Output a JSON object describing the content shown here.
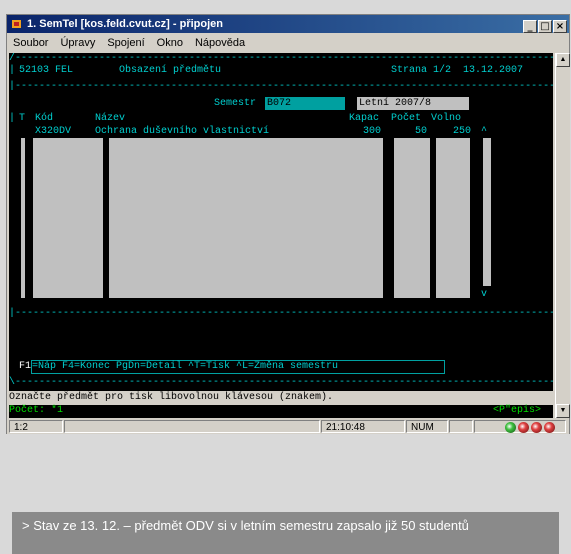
{
  "window": {
    "title": "1. SemTel [kos.feld.cvut.cz] - připojen",
    "controls": [
      "_",
      "□",
      "×"
    ]
  },
  "menu": [
    "Soubor",
    "Úpravy",
    "Spojení",
    "Okno",
    "Nápověda"
  ],
  "terminal": {
    "header_left": "52103 FEL",
    "header_title": "Obsazení předmětu",
    "header_page": "Strana 1/2",
    "header_date": "13.12.2007",
    "semestr_label": "Semestr",
    "semestr_code": "B072",
    "semestr_name": "Letní 2007/8",
    "columns": {
      "t": "T",
      "kod": "Kód",
      "nazev": "Název",
      "kapac": "Kapac",
      "pocet": "Počet",
      "volno": "Volno"
    },
    "rows": [
      {
        "kod": "X320DV",
        "nazev": "Ochrana duševního vlastnictví",
        "kapac": "300",
        "pocet": "50",
        "volno": "250"
      }
    ],
    "scroll_up": "^",
    "scroll_down": "v",
    "fkeys_label": "F1",
    "fkeys_text": "=Náp F4=Konec PgDn=Detail ^T=Tisk ^L=Změna semestru",
    "prompt": "Označte předmět pro tisk libovolnou klávesou (znakem).",
    "count": "Počet: *1",
    "status_right": "<P\"epis>"
  },
  "statusbar": {
    "pos": "1:2",
    "time": "21:10:48",
    "mode": "NUM"
  },
  "caption": "> Stav ze 13. 12. – předmět ODV si v letním semestru zapsalo již 50 studentů",
  "colors": {
    "terminal_fg": "#00d0d0",
    "terminal_bg": "#000000",
    "highlight": "#00a0a0"
  }
}
